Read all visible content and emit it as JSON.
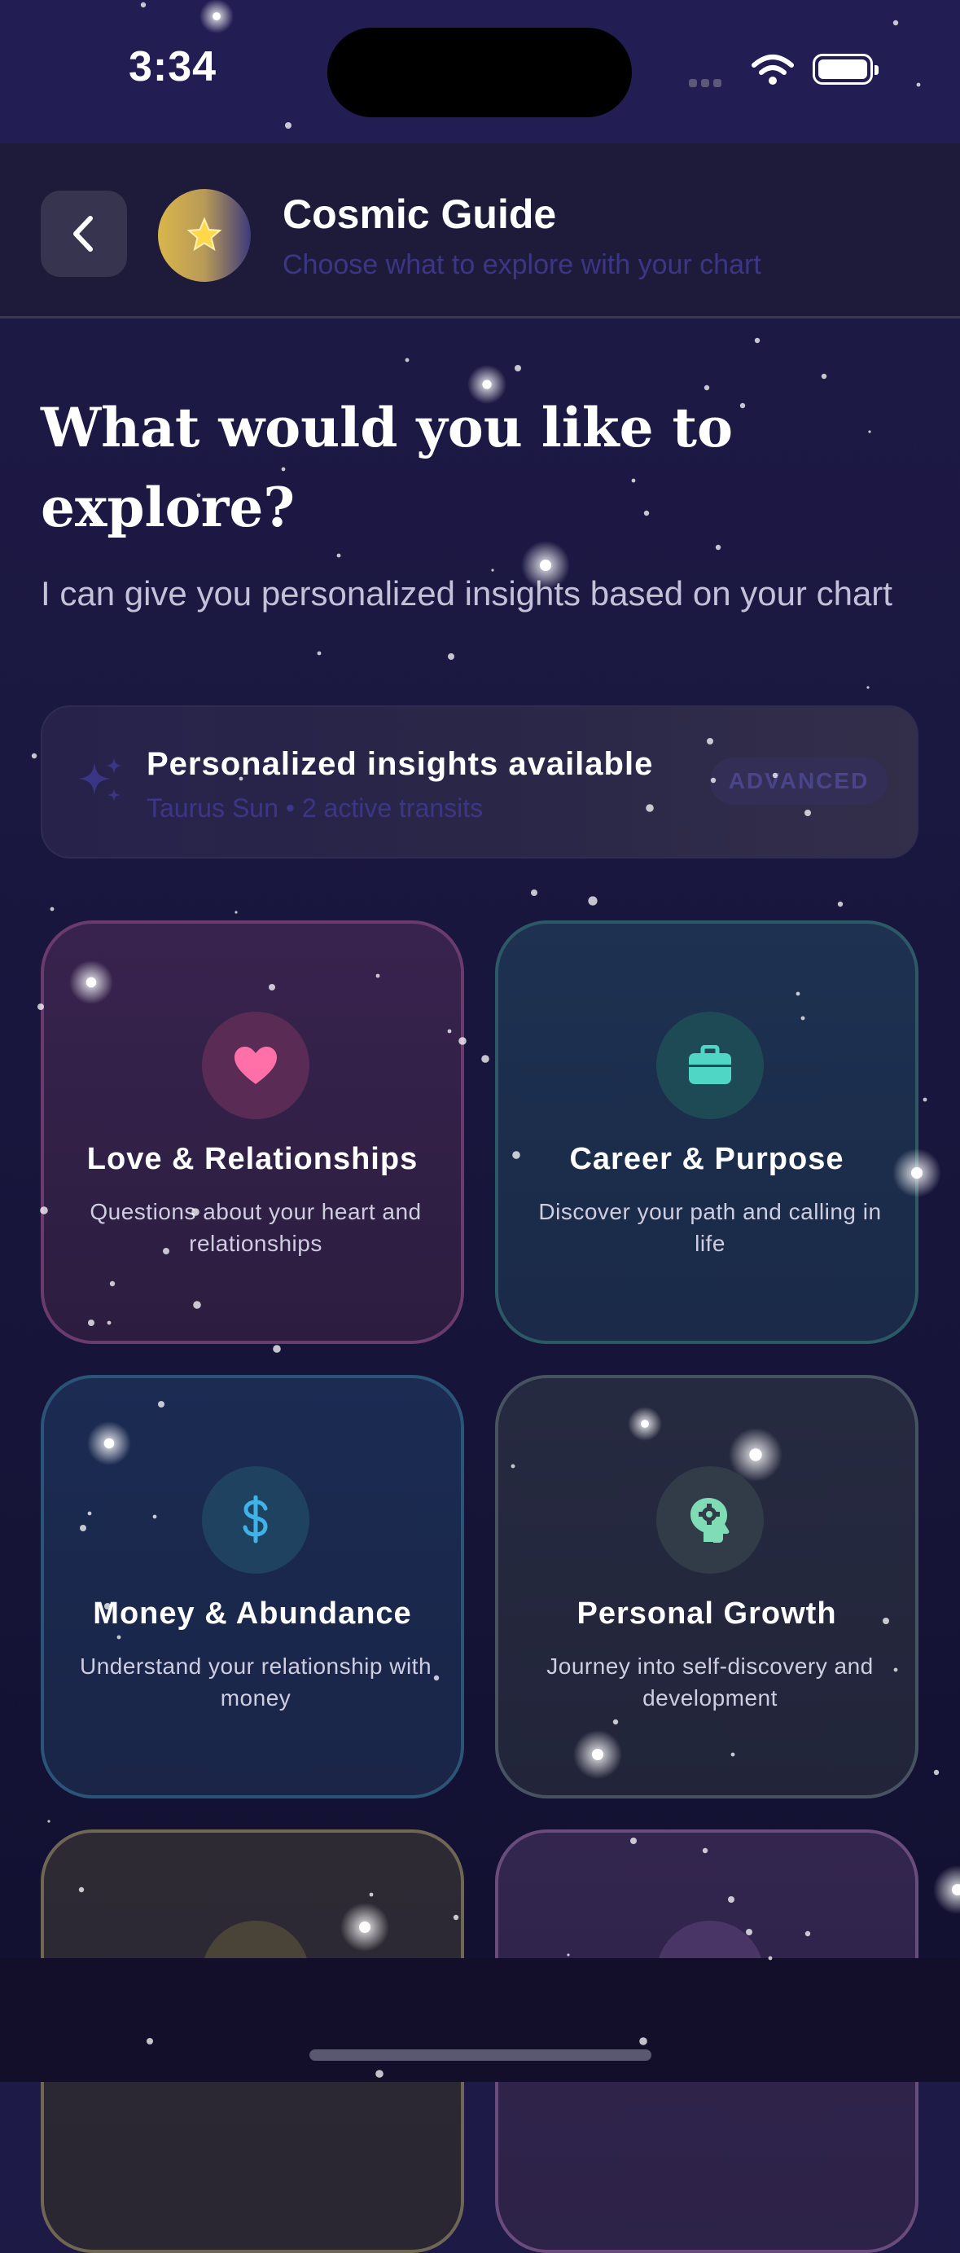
{
  "status": {
    "time": "3:34"
  },
  "header": {
    "back_icon": "chevron-left-icon",
    "avatar_icon": "star-icon",
    "title": "Cosmic Guide",
    "subtitle": "Choose what to explore with your chart"
  },
  "main": {
    "headline": "What would you like to explore?",
    "subtext": "I can give you personalized insights based on your chart"
  },
  "insights": {
    "icon": "sparkles-icon",
    "title": "Personalized insights available",
    "subtitle": "Taurus Sun • 2 active transits",
    "badge": "ADVANCED"
  },
  "topics": [
    {
      "title": "Love & Relationships",
      "description": "Questions about your heart and relationships",
      "icon": "heart-icon",
      "color": "#ff6fa8"
    },
    {
      "title": "Career & Purpose",
      "description": "Discover your path and calling in life",
      "icon": "briefcase-icon",
      "color": "#4fd6c4"
    },
    {
      "title": "Money & Abundance",
      "description": "Understand your relationship with money",
      "icon": "dollar-icon",
      "color": "#3fb3e8"
    },
    {
      "title": "Personal Growth",
      "description": "Journey into self-discovery and development",
      "icon": "head-gear-icon",
      "color": "#7fdcb4"
    }
  ],
  "colors": {
    "background": "#1b1842",
    "muted_text": "#3b3685",
    "body_text": "#c3c1d8"
  }
}
